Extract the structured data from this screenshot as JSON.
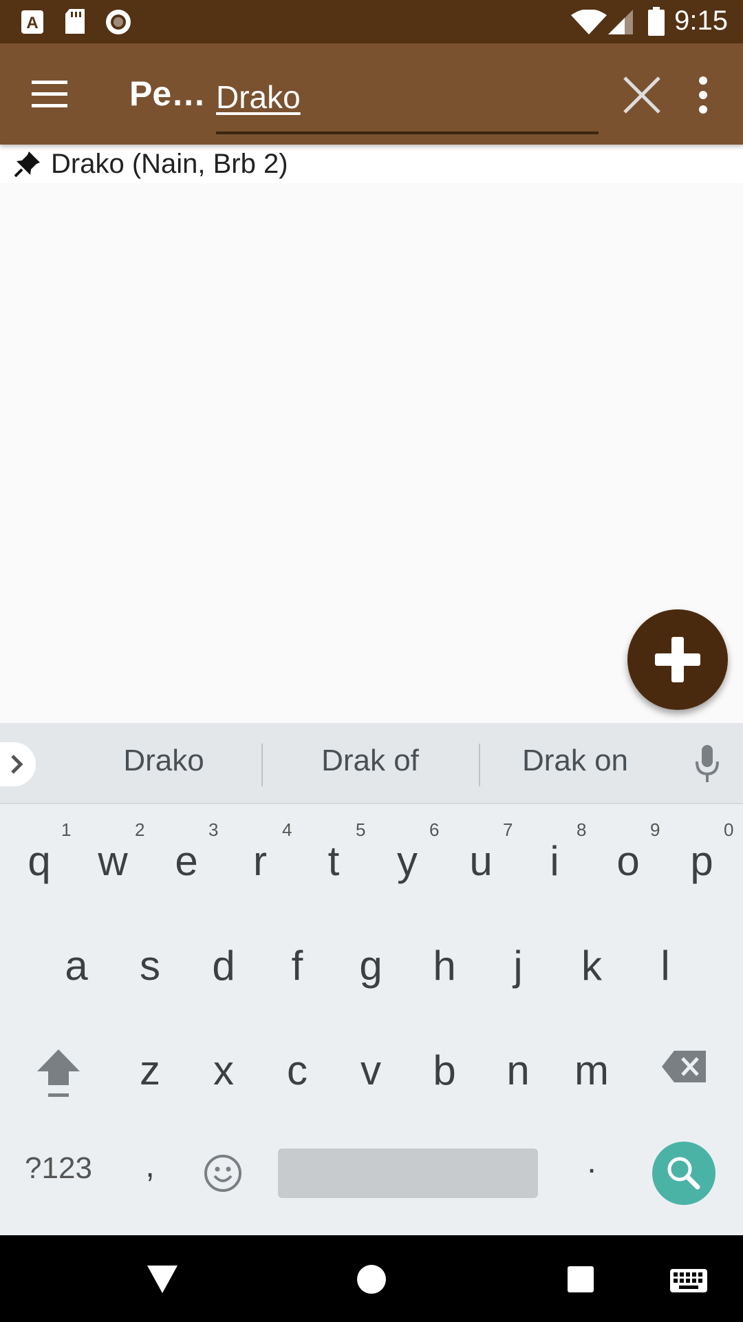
{
  "status_bar": {
    "time": "9:15",
    "icons": [
      "font-a-icon",
      "sd-card-icon",
      "record-icon",
      "wifi-icon",
      "signal-icon",
      "battery-icon"
    ]
  },
  "app_bar": {
    "title": "Pe…",
    "search_value": "Drako",
    "icons": [
      "menu-icon",
      "close-icon",
      "more-vert-icon"
    ]
  },
  "list": {
    "items": [
      {
        "label": "Drako (Nain, Brb 2)",
        "icon": "pin-icon"
      }
    ]
  },
  "fab": {
    "icon": "plus-icon"
  },
  "suggestions": [
    "Drako",
    "Drak of",
    "Drak on"
  ],
  "keyboard": {
    "row1": [
      {
        "k": "q",
        "h": "1"
      },
      {
        "k": "w",
        "h": "2"
      },
      {
        "k": "e",
        "h": "3"
      },
      {
        "k": "r",
        "h": "4"
      },
      {
        "k": "t",
        "h": "5"
      },
      {
        "k": "y",
        "h": "6"
      },
      {
        "k": "u",
        "h": "7"
      },
      {
        "k": "i",
        "h": "8"
      },
      {
        "k": "o",
        "h": "9"
      },
      {
        "k": "p",
        "h": "0"
      }
    ],
    "row2": [
      "a",
      "s",
      "d",
      "f",
      "g",
      "h",
      "j",
      "k",
      "l"
    ],
    "row3": [
      "z",
      "x",
      "c",
      "v",
      "b",
      "n",
      "m"
    ],
    "symbols_key": "?123",
    "comma_key": ",",
    "period_key": "."
  },
  "colors": {
    "status_bar": "#543214",
    "app_bar": "#7a5230",
    "fab": "#4a2a0e",
    "keyboard_action": "#4bb3a5"
  }
}
